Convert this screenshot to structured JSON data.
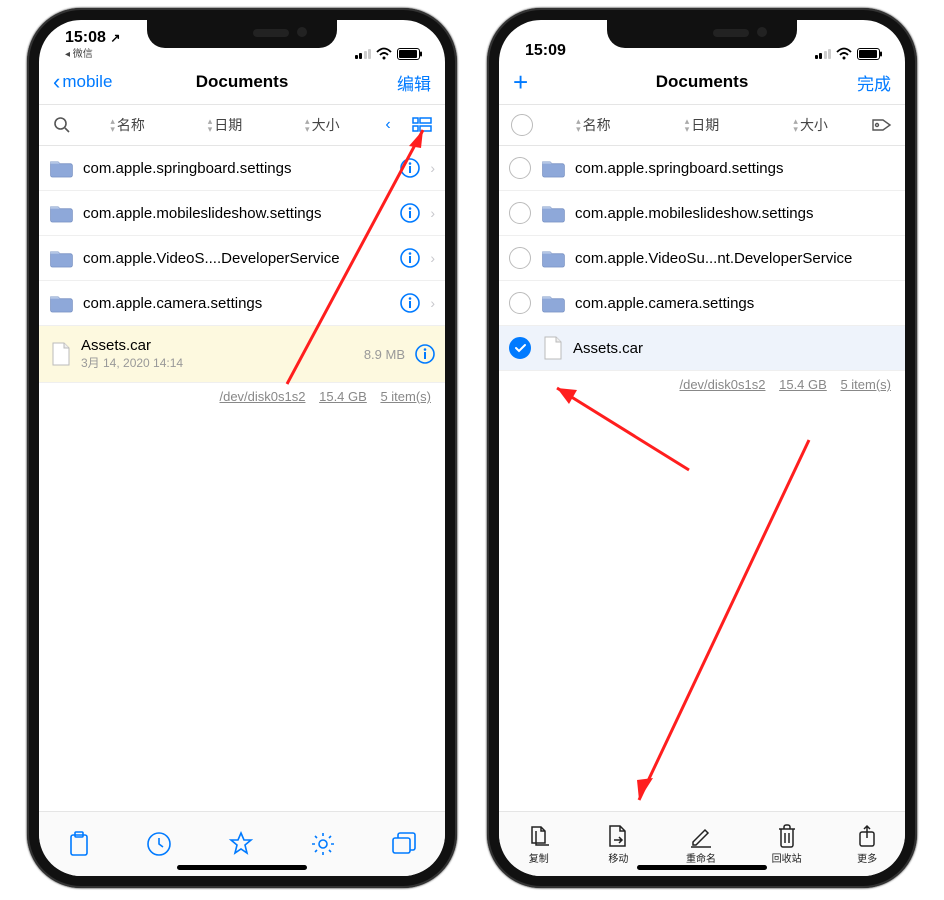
{
  "left": {
    "status": {
      "time": "15:08",
      "loc_arrow": "↗",
      "back_app": "◂ 微信"
    },
    "nav": {
      "back": "mobile",
      "title": "Documents",
      "action": "编辑"
    },
    "sort": {
      "c1": "名称",
      "c2": "日期",
      "c3": "大小"
    },
    "rows": [
      {
        "name": "com.apple.springboard.settings",
        "type": "folder"
      },
      {
        "name": "com.apple.mobileslideshow.settings",
        "type": "folder"
      },
      {
        "name": "com.apple.VideoS....DeveloperService",
        "type": "folder"
      },
      {
        "name": "com.apple.camera.settings",
        "type": "folder"
      },
      {
        "name": "Assets.car",
        "type": "file",
        "sub": "3月 14, 2020 14:14",
        "meta": "8.9 MB",
        "selected": true
      }
    ],
    "footer": {
      "path": "/dev/disk0s1s2",
      "size": "15.4 GB",
      "count": "5 item(s)"
    }
  },
  "right": {
    "status": {
      "time": "15:09"
    },
    "nav": {
      "add": "+",
      "title": "Documents",
      "action": "完成"
    },
    "sort": {
      "c1": "名称",
      "c2": "日期",
      "c3": "大小"
    },
    "rows": [
      {
        "name": "com.apple.springboard.settings",
        "type": "folder"
      },
      {
        "name": "com.apple.mobileslideshow.settings",
        "type": "folder"
      },
      {
        "name": "com.apple.VideoSu...nt.DeveloperService",
        "type": "folder"
      },
      {
        "name": "com.apple.camera.settings",
        "type": "folder"
      },
      {
        "name": "Assets.car",
        "type": "file",
        "checked": true
      }
    ],
    "footer": {
      "path": "/dev/disk0s1s2",
      "size": "15.4 GB",
      "count": "5 item(s)"
    },
    "tools": {
      "copy": "复制",
      "move": "移动",
      "rename": "重命名",
      "trash": "回收站",
      "more": "更多"
    }
  }
}
